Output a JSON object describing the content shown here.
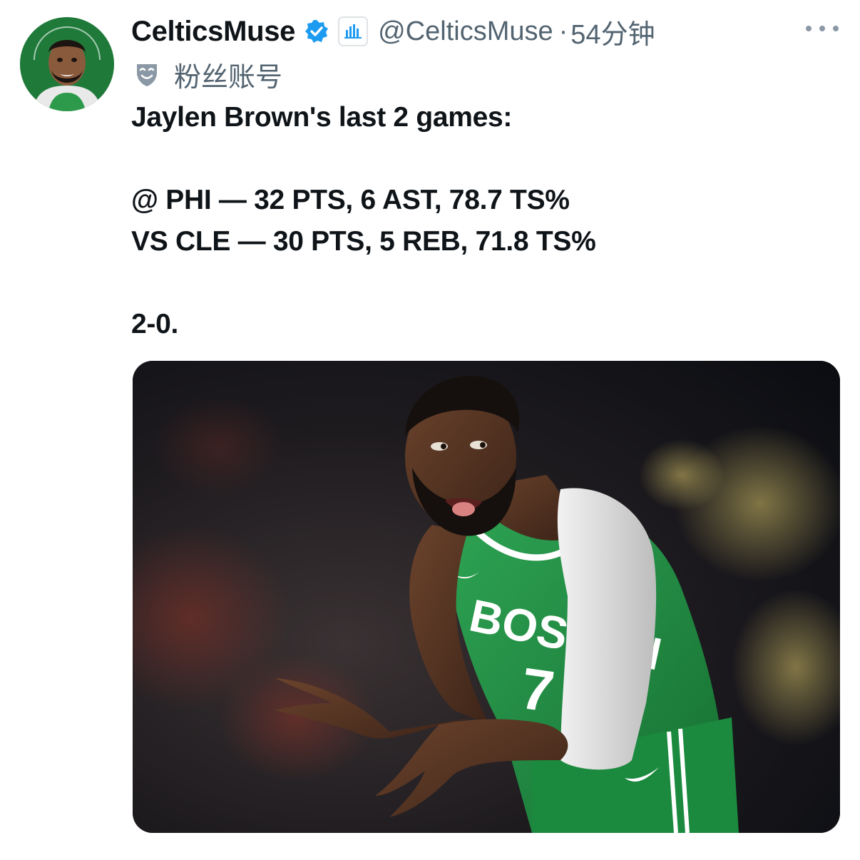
{
  "tweet": {
    "display_name": "CelticsMuse",
    "handle": "@CelticsMuse",
    "separator": "·",
    "time": "54分钟",
    "fan_label": "粉丝账号",
    "icons": {
      "verified": "verified-badge-icon",
      "affiliate": "bar-chart-badge-icon",
      "fan": "fan-mask-icon",
      "more": "more-dots-icon"
    },
    "lines": [
      "Jaylen Brown's last 2 games:",
      "",
      "@ PHI — 32 PTS, 6 AST, 78.7 TS%",
      "VS CLE — 30 PTS, 5 REB, 71.8 TS%",
      "",
      "2-0."
    ],
    "media": {
      "jersey_text": "BOSTON",
      "jersey_number": "7"
    }
  },
  "colors": {
    "verified_blue": "#1d9bf0",
    "secondary_text": "#536471",
    "celtics_green": "#1f8a3c"
  }
}
